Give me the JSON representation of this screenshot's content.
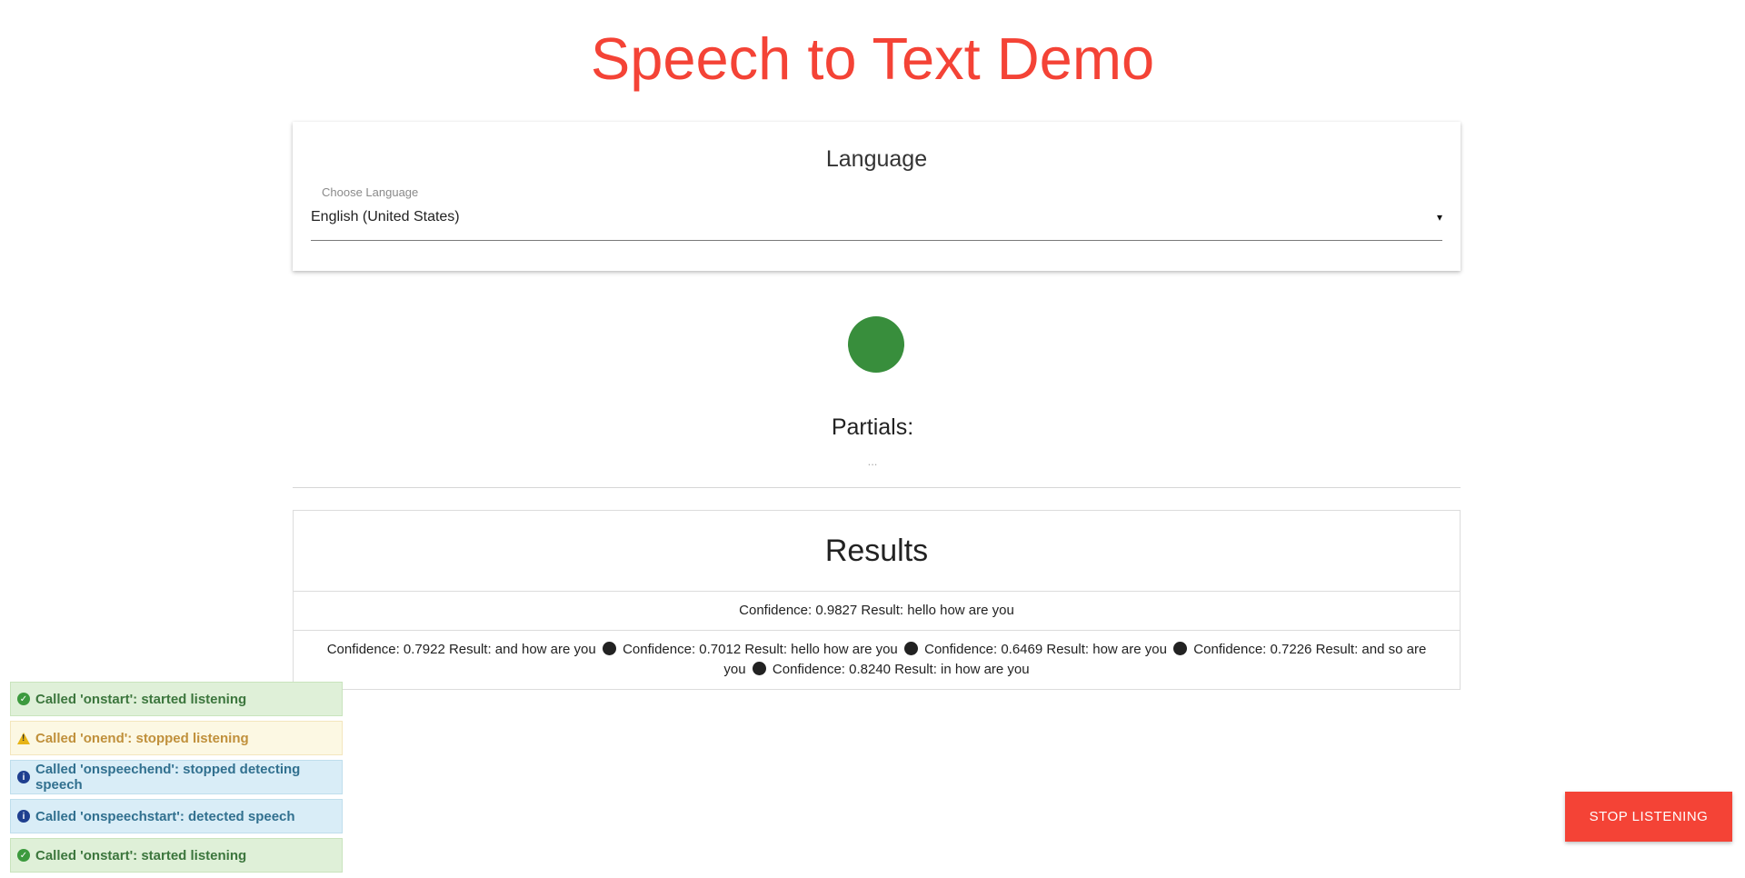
{
  "header": {
    "title": "Speech to Text Demo"
  },
  "language": {
    "title": "Language",
    "caption": "Choose Language",
    "selected": "English (United States)",
    "caret": "▾"
  },
  "mic": {
    "state_color": "#388e3c"
  },
  "partials": {
    "title": "Partials:",
    "text": "..."
  },
  "results": {
    "title": "Results",
    "top": "Confidence: 0.9827 Result: hello how are you",
    "alternatives": [
      "Confidence: 0.7922 Result: and how are you",
      "Confidence: 0.7012 Result: hello how are you",
      "Confidence: 0.6469 Result: how are you",
      "Confidence: 0.7226 Result: and so are you",
      "Confidence: 0.8240 Result: in how are you"
    ]
  },
  "toasts": [
    {
      "type": "success",
      "icon": "check-circle-icon",
      "text": "Called 'onstart': started listening"
    },
    {
      "type": "warning",
      "icon": "warning-icon",
      "text": "Called 'onend': stopped listening"
    },
    {
      "type": "info",
      "icon": "info-icon",
      "text": "Called 'onspeechend': stopped detecting speech"
    },
    {
      "type": "info",
      "icon": "info-icon",
      "text": "Called 'onspeechstart': detected speech"
    },
    {
      "type": "success",
      "icon": "check-circle-icon",
      "text": "Called 'onstart': started listening"
    }
  ],
  "actions": {
    "stop_label": "STOP LISTENING"
  },
  "colors": {
    "accent": "#f44336",
    "mic_active": "#388e3c"
  }
}
